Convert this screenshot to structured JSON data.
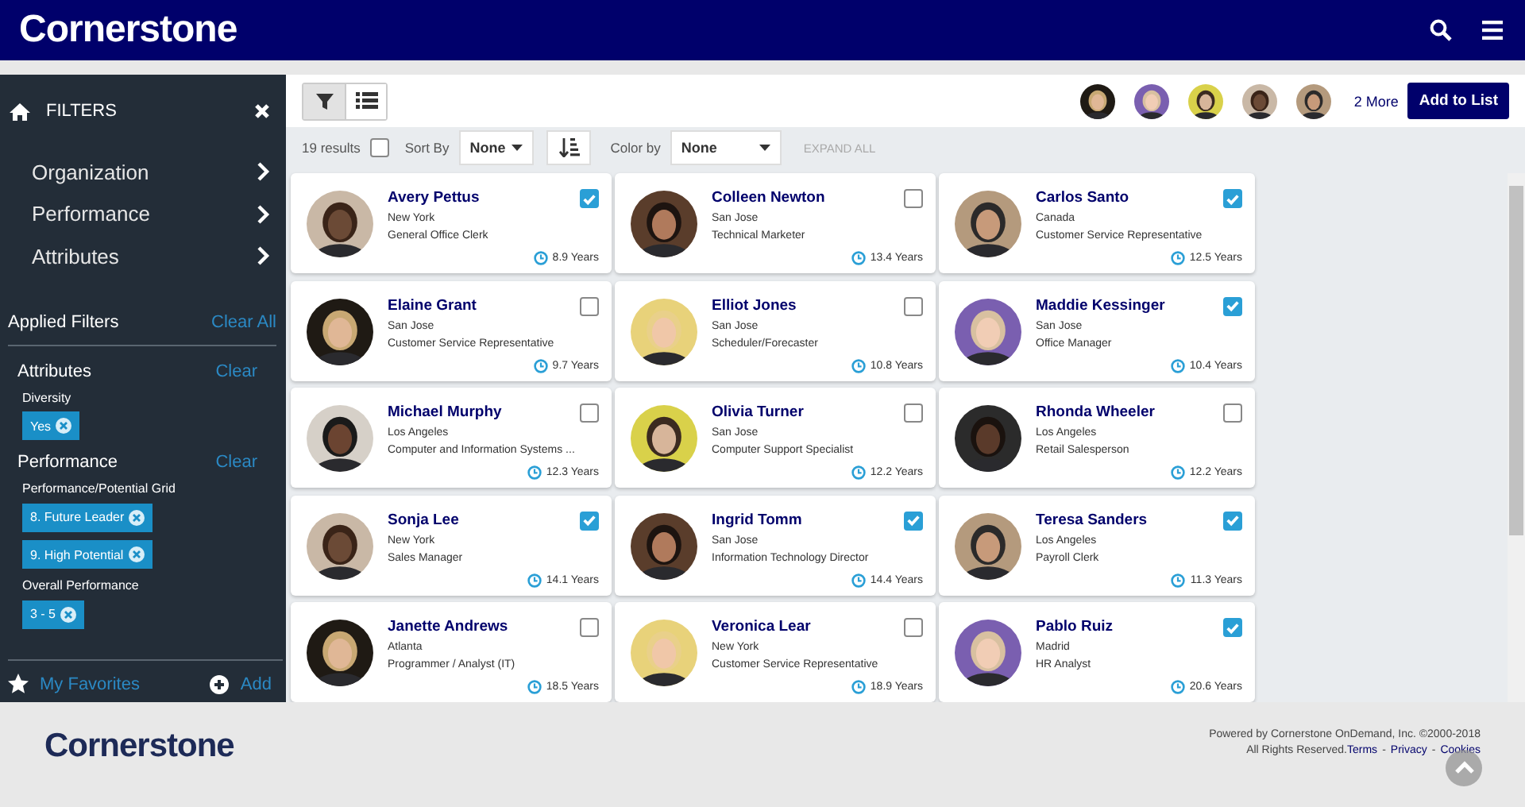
{
  "header": {
    "logo": "Cornerstone"
  },
  "sidebar": {
    "title": "FILTERS",
    "nav": [
      {
        "label": "Organization"
      },
      {
        "label": "Performance"
      },
      {
        "label": "Attributes"
      }
    ],
    "applied_title": "Applied Filters",
    "clear_all": "Clear All",
    "groups": [
      {
        "title": "Attributes",
        "clear": "Clear",
        "filters": [
          {
            "label": "Diversity",
            "tags": [
              "Yes"
            ]
          }
        ]
      },
      {
        "title": "Performance",
        "clear": "Clear",
        "filters": [
          {
            "label": "Performance/Potential Grid",
            "tags": [
              "8. Future Leader",
              "9. High Potential"
            ]
          },
          {
            "label": "Overall Performance",
            "tags": [
              "3 - 5"
            ]
          }
        ]
      }
    ],
    "favorites": "My Favorites",
    "add": "Add"
  },
  "toolbar": {
    "views": [
      {
        "kind": "filter",
        "selected": true
      },
      {
        "kind": "list",
        "selected": false
      }
    ],
    "more": "2 More",
    "add_button": "Add to List"
  },
  "results": {
    "count": "19 results",
    "select_all": false,
    "sort_label": "Sort By",
    "sort_value": "None",
    "color_label": "Color by",
    "color_value": "None",
    "expand": "EXPAND ALL"
  },
  "people": [
    {
      "name": "Avery Pettus",
      "location": "New York",
      "title": "General Office Clerk",
      "tenure": "8.9 Years",
      "checked": true
    },
    {
      "name": "Colleen Newton",
      "location": "San Jose",
      "title": "Technical Marketer",
      "tenure": "13.4 Years",
      "checked": false
    },
    {
      "name": "Carlos Santo",
      "location": "Canada",
      "title": "Customer Service Representative",
      "tenure": "12.5 Years",
      "checked": true
    },
    {
      "name": "Elaine Grant",
      "location": "San Jose",
      "title": "Customer Service Representative",
      "tenure": "9.7 Years",
      "checked": false
    },
    {
      "name": "Elliot Jones",
      "location": "San Jose",
      "title": "Scheduler/Forecaster",
      "tenure": "10.8 Years",
      "checked": false
    },
    {
      "name": "Maddie Kessinger",
      "location": "San Jose",
      "title": "Office Manager",
      "tenure": "10.4 Years",
      "checked": true
    },
    {
      "name": "Michael Murphy",
      "location": "Los Angeles",
      "title": "Computer and Information Systems ...",
      "tenure": "12.3 Years",
      "checked": false
    },
    {
      "name": "Olivia Turner",
      "location": "San Jose",
      "title": "Computer Support Specialist",
      "tenure": "12.2 Years",
      "checked": false
    },
    {
      "name": "Rhonda Wheeler",
      "location": "Los Angeles",
      "title": "Retail Salesperson",
      "tenure": "12.2 Years",
      "checked": false
    },
    {
      "name": "Sonja Lee",
      "location": "New York",
      "title": "Sales Manager",
      "tenure": "14.1 Years",
      "checked": true
    },
    {
      "name": "Ingrid Tomm",
      "location": "San Jose",
      "title": "Information Technology Director",
      "tenure": "14.4 Years",
      "checked": true
    },
    {
      "name": "Teresa Sanders",
      "location": "Los Angeles",
      "title": "Payroll Clerk",
      "tenure": "11.3 Years",
      "checked": true
    },
    {
      "name": "Janette Andrews",
      "location": "Atlanta",
      "title": "Programmer / Analyst (IT)",
      "tenure": "18.5 Years",
      "checked": false
    },
    {
      "name": "Veronica Lear",
      "location": "New York",
      "title": "Customer Service Representative",
      "tenure": "18.9 Years",
      "checked": false
    },
    {
      "name": "Pablo Ruiz",
      "location": "Madrid",
      "title": "HR Analyst",
      "tenure": "20.6 Years",
      "checked": true
    }
  ],
  "footer": {
    "logo": "Cornerstone",
    "powered": "Powered by Cornerstone OnDemand, Inc. ©2000-2018",
    "rights": "All Rights Reserved.",
    "links": [
      "Terms",
      "Privacy",
      "Cookies"
    ],
    "separator": "-"
  }
}
